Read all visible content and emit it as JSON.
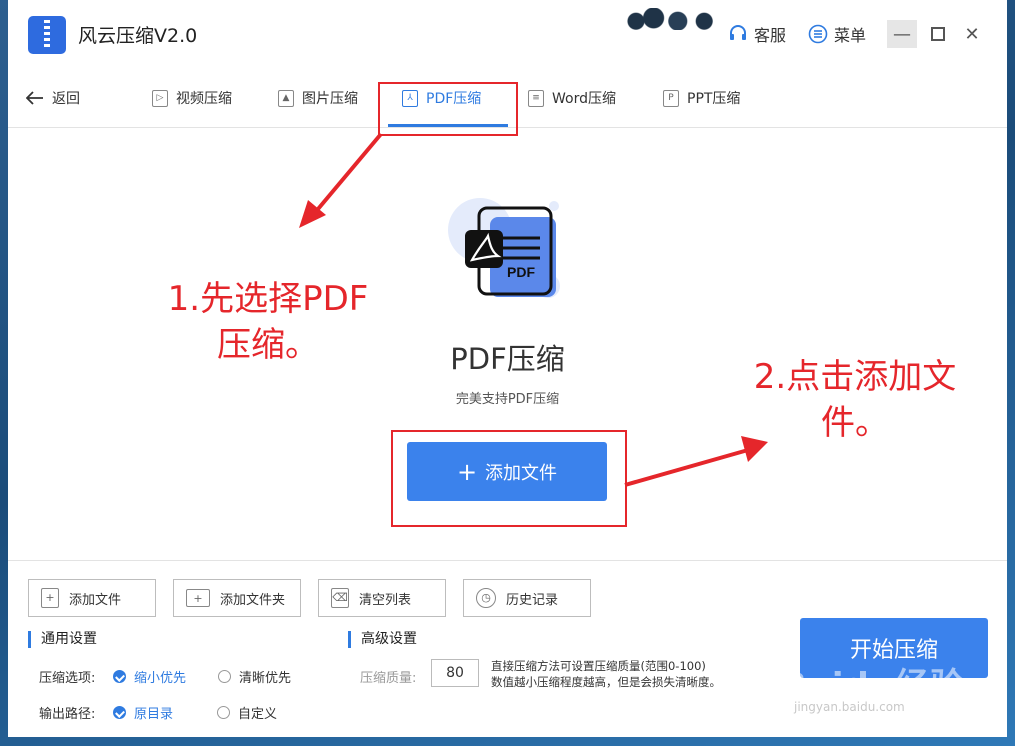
{
  "app": {
    "title": "风云压缩V2.0",
    "service_label": "客服",
    "menu_label": "菜单"
  },
  "tabs": {
    "back_label": "返回",
    "items": [
      {
        "label": "视频压缩",
        "icon": "play-icon"
      },
      {
        "label": "图片压缩",
        "icon": "image-icon"
      },
      {
        "label": "PDF压缩",
        "icon": "pdf-icon",
        "active": true
      },
      {
        "label": "Word压缩",
        "icon": "doc-icon"
      },
      {
        "label": "PPT压缩",
        "icon": "ppt-icon"
      }
    ]
  },
  "main": {
    "title": "PDF压缩",
    "subtitle": "完美支持PDF压缩",
    "add_button": "添加文件",
    "hero_badge": "PDF"
  },
  "annotations": {
    "step1": "1.先选择PDF压缩。",
    "step2": "2.点击添加文件。"
  },
  "toolbar": {
    "add_file": "添加文件",
    "add_folder": "添加文件夹",
    "clear_list": "清空列表",
    "history": "历史记录"
  },
  "general": {
    "title": "通用设置",
    "compress_option_label": "压缩选项:",
    "option_small": "缩小优先",
    "option_clear": "清晰优先",
    "output_label": "输出路径:",
    "output_original": "原目录",
    "output_custom": "自定义"
  },
  "advanced": {
    "title": "高级设置",
    "quality_label": "压缩质量:",
    "quality_value": "80",
    "desc_line1": "直接压缩方法可设置压缩质量(范围0-100)",
    "desc_line2": "数值越小压缩程度越高，但是会损失清晰度。"
  },
  "start_button": "开始压缩",
  "watermark": {
    "brand": "Baidu经验",
    "url": "jingyan.baidu.com"
  },
  "colors": {
    "accent": "#3b82ec",
    "annotation": "#e5262b"
  }
}
